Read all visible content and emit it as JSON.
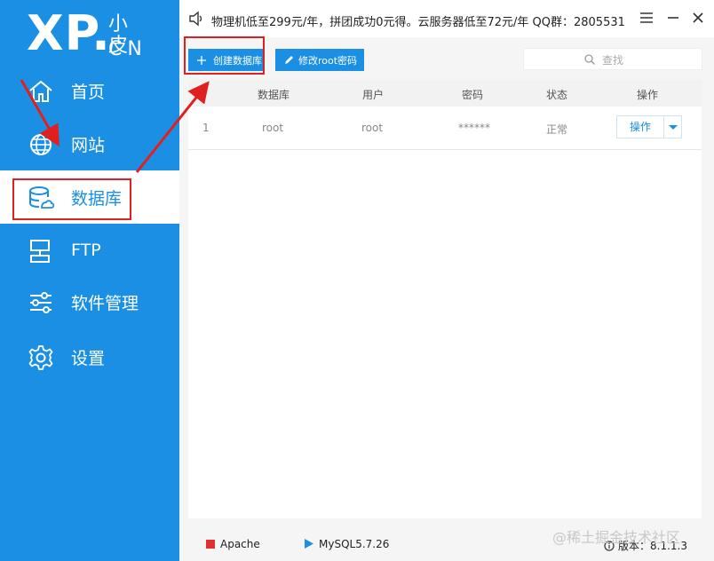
{
  "logo": {
    "mark": "XP.",
    "small": "小皮",
    "domain": "CN"
  },
  "sidebar": {
    "items": [
      {
        "label": "首页",
        "icon": "home-icon"
      },
      {
        "label": "网站",
        "icon": "globe-icon"
      },
      {
        "label": "数据库",
        "icon": "database-icon",
        "active": true
      },
      {
        "label": "FTP",
        "icon": "ftp-icon"
      },
      {
        "label": "软件管理",
        "icon": "sliders-icon"
      },
      {
        "label": "设置",
        "icon": "gear-icon"
      }
    ]
  },
  "topbar": {
    "notice": "物理机低至299元/年，拼团成功0元得。云服务器低至72元/年  QQ群：2805531"
  },
  "toolbar": {
    "create_label": "创建数据库",
    "modify_label": "修改root密码",
    "search_placeholder": "查找"
  },
  "table": {
    "headers": [
      "数据库",
      "用户",
      "密码",
      "状态",
      "操作"
    ],
    "rows": [
      {
        "index": "1",
        "database": "root",
        "user": "root",
        "password": "******",
        "status": "正常",
        "action": "操作"
      }
    ]
  },
  "statusbar": {
    "apache": "Apache",
    "mysql": "MySQL5.7.26",
    "version": "版本：8.1.1.3"
  },
  "watermark": "@稀土掘金技术社区",
  "colors": {
    "accent": "#1a8fe3",
    "annotation": "#e02020",
    "apache_status": "#e03030"
  }
}
